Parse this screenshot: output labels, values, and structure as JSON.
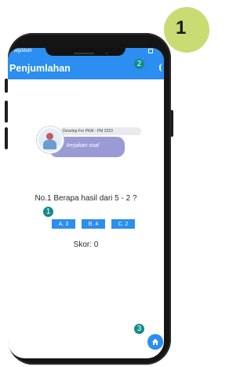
{
  "tutorial": {
    "step_badge": "1"
  },
  "status_bar": {
    "app_name": "digiMath"
  },
  "app_bar": {
    "title": "Penjumlahan"
  },
  "markers": {
    "m1": "1",
    "m2": "2",
    "m3": "3"
  },
  "speech": {
    "chip_text": "Develop For PKM - PM 2023",
    "bubble_text": "kerjakan soal"
  },
  "quiz": {
    "question": "No.1 Berapa hasil dari 5 - 2 ?",
    "options": [
      "A. 3",
      "B. 4",
      "C. 2"
    ],
    "score_text": "Skor: 0"
  },
  "colors": {
    "primary": "#2b8ef0",
    "marker": "#128a8a",
    "bubble": "#9a9ad4",
    "step_circle": "#c9dc74"
  },
  "icons": {
    "fab": "home-icon",
    "avatar": "mascot-avatar"
  }
}
